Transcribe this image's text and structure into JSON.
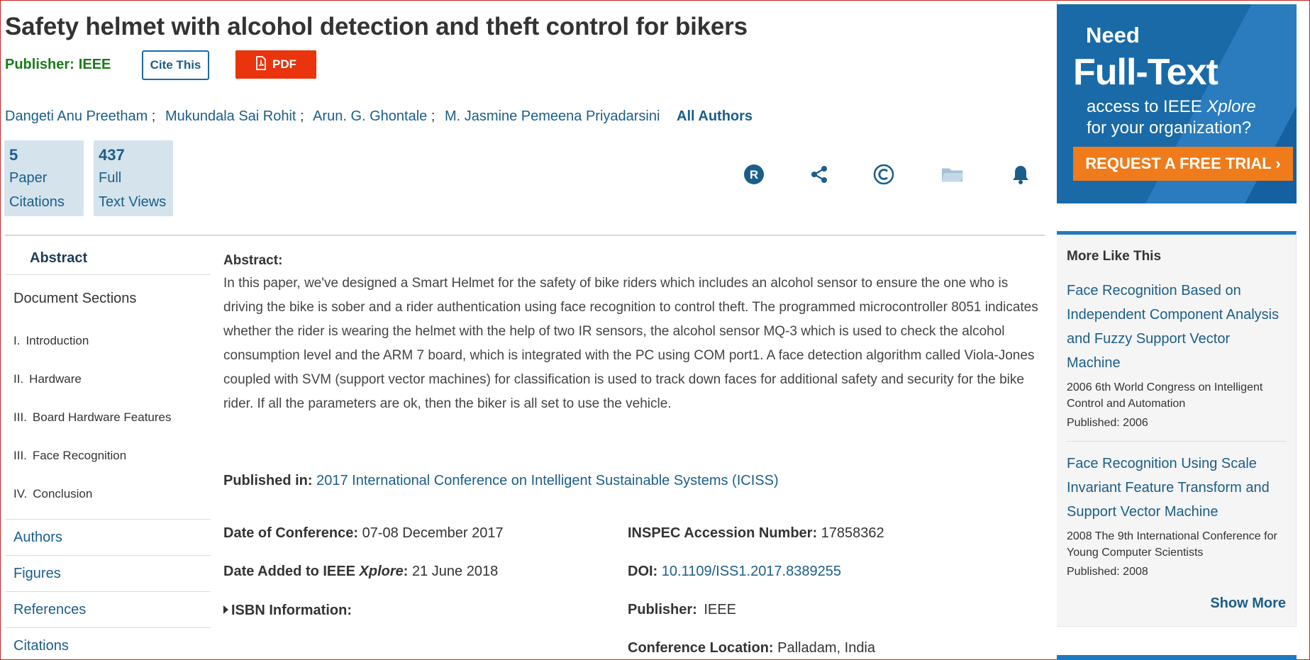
{
  "title": "Safety helmet with alcohol detection and theft control for bikers",
  "publisher": {
    "label": "Publisher:",
    "value": "IEEE"
  },
  "buttons": {
    "cite": "Cite This",
    "pdf": "PDF"
  },
  "authors": [
    "Dangeti Anu Preetham",
    "Mukundala Sai Rohit",
    "Arun. G. Ghontale",
    "M. Jasmine Pemeena Priyadarsini"
  ],
  "all_authors": "All Authors",
  "metrics": {
    "citations": {
      "num": "5",
      "line1": "Paper",
      "line2": "Citations"
    },
    "views": {
      "num": "437",
      "line1": "Full",
      "line2": "Text Views"
    }
  },
  "toolbar_icons": [
    "rights-icon",
    "share-icon",
    "copyright-icon",
    "folder-icon",
    "bell-icon"
  ],
  "nav": {
    "abstract": "Abstract",
    "doc_sections": "Document Sections",
    "sections": [
      {
        "ord": "I.",
        "label": "Introduction"
      },
      {
        "ord": "II.",
        "label": "Hardware"
      },
      {
        "ord": "III.",
        "label": "Board Hardware Features"
      },
      {
        "ord": "III.",
        "label": "Face Recognition"
      },
      {
        "ord": "IV.",
        "label": "Conclusion"
      }
    ],
    "links": [
      "Authors",
      "Figures",
      "References",
      "Citations"
    ]
  },
  "abstract": {
    "heading": "Abstract:",
    "text": "In this paper, we've designed a Smart Helmet for the safety of bike riders which includes an alcohol sensor to ensure the one who is driving the bike is sober and a rider authentication using face recognition to control theft. The programmed microcontroller 8051 indicates whether the rider is wearing the helmet with the help of two IR sensors, the alcohol sensor MQ-3 which is used to check the alcohol consumption level and the ARM 7 board, which is integrated with the PC using COM port1. A face detection algorithm called Viola-Jones coupled with SVM (support vector machines) for classification is used to track down faces for additional safety and security for the bike rider. If all the parameters are ok, then the biker is all set to use the vehicle."
  },
  "published_in": {
    "label": "Published in:",
    "value": "2017 International Conference on Intelligent Sustainable Systems (ICISS)"
  },
  "meta": {
    "date_conf_label": "Date of Conference:",
    "date_conf_value": "07-08 December 2017",
    "date_added_label_pre": "Date Added to IEEE ",
    "date_added_label_em": "Xplore",
    "date_added_label_post": ":",
    "date_added_value": "21 June 2018",
    "isbn_label": "ISBN Information:",
    "inspec_label": "INSPEC Accession Number:",
    "inspec_value": "17858362",
    "doi_label": "DOI:",
    "doi_value": "10.1109/ISS1.2017.8389255",
    "publisher_label": "Publisher:",
    "publisher_value": "IEEE",
    "location_label": "Conference Location:",
    "location_value": "Palladam, India"
  },
  "ad": {
    "line1": "Need",
    "line2": "Full-Text",
    "line3_pre": "access to IEEE ",
    "line3_em": "Xplore",
    "line4": "for your organization?",
    "cta": "REQUEST A FREE TRIAL ›"
  },
  "more_like_this": {
    "heading": "More Like This",
    "items": [
      {
        "title": "Face Recognition Based on Independent Component Analysis and Fuzzy Support Vector Machine",
        "venue": "2006 6th World Congress on Intelligent Control and Automation",
        "published": "Published: 2006"
      },
      {
        "title": "Face Recognition Using Scale Invariant Feature Transform and Support Vector Machine",
        "venue": "2008 The 9th International Conference for Young Computer Scientists",
        "published": "Published: 2008"
      }
    ],
    "show_more": "Show More"
  },
  "colors": {
    "accent": "#1b5e8a",
    "pdf": "#e9340d",
    "publisher_green": "#1a7a1a",
    "ad_orange": "#f07b1a"
  }
}
